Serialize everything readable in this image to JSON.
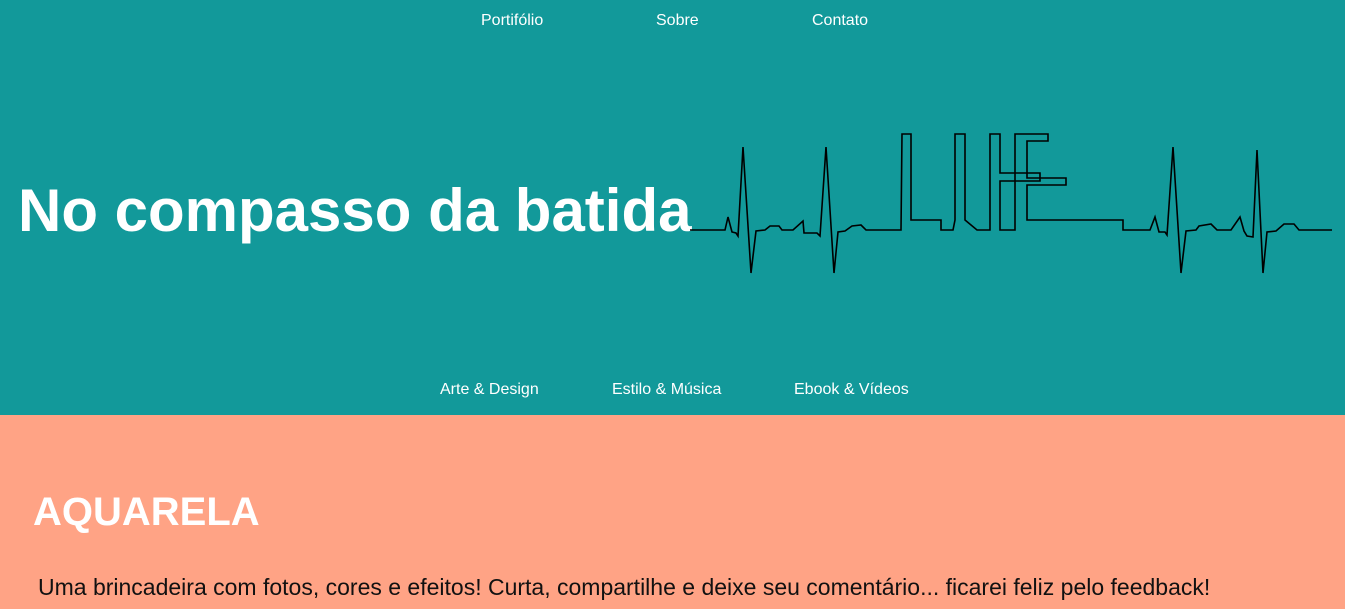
{
  "colors": {
    "header_bg": "#12999a",
    "section_bg": "#ffa385",
    "nav_text": "#ffffff",
    "body_text": "#111111",
    "logo_stroke": "#000000"
  },
  "top_nav": {
    "items": [
      "Portifólio",
      "Sobre",
      "Contato"
    ]
  },
  "hero": {
    "title": "No compasso da batida",
    "logo_icon": "life-heartbeat-logo-icon",
    "logo_text": "LIFE"
  },
  "sub_nav": {
    "items": [
      "Arte & Design",
      "Estilo & Música",
      "Ebook & Vídeos"
    ]
  },
  "section": {
    "title": "AQUARELA",
    "text": "Uma brincadeira com fotos, cores e efeitos! Curta, compartilhe e deixe seu comentário... ficarei feliz pelo feedback!"
  }
}
